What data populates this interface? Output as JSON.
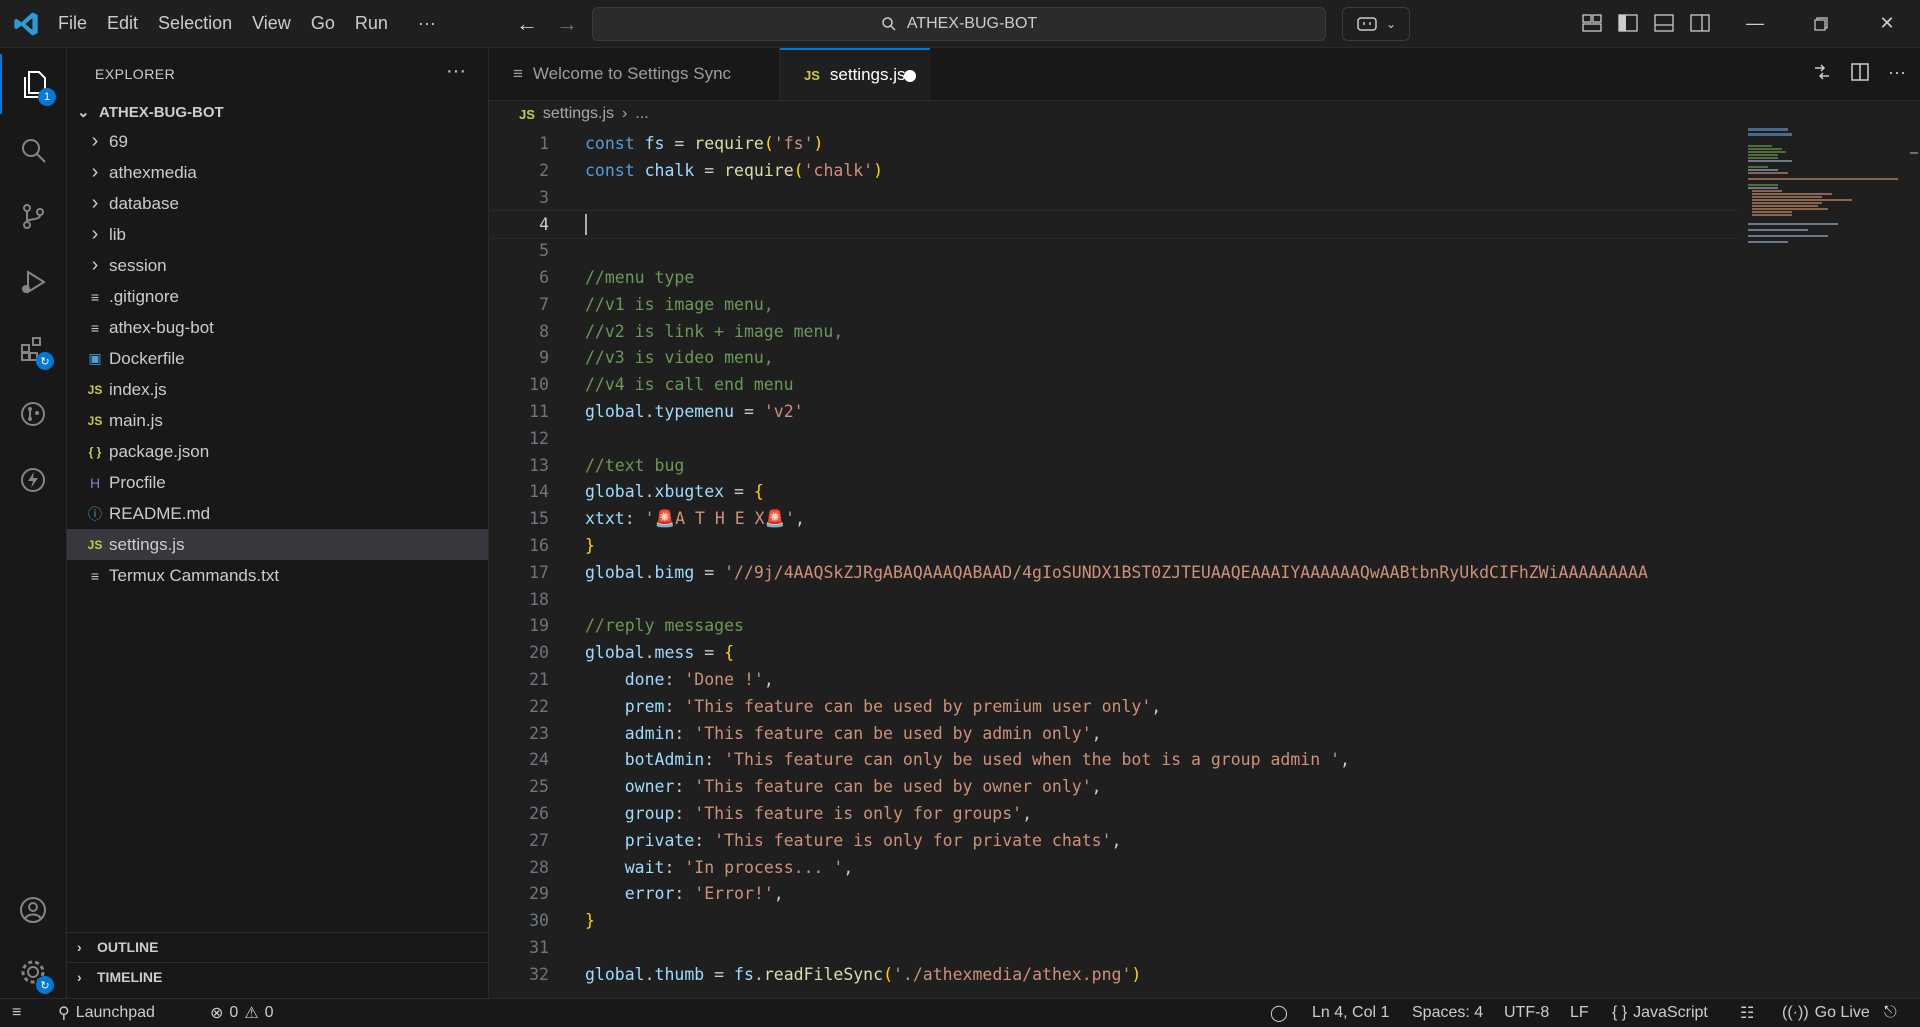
{
  "titlebar": {
    "menus": [
      "File",
      "Edit",
      "Selection",
      "View",
      "Go",
      "Run",
      "···"
    ],
    "search_text": "ATHEX-BUG-BOT"
  },
  "activitybar": {
    "explorer_badge": "1"
  },
  "sidebar": {
    "title": "EXPLORER",
    "more": "···",
    "root": "ATHEX-BUG-BOT",
    "items": [
      {
        "label": "69",
        "kind": "folder"
      },
      {
        "label": "athexmedia",
        "kind": "folder"
      },
      {
        "label": "database",
        "kind": "folder"
      },
      {
        "label": "lib",
        "kind": "folder"
      },
      {
        "label": "session",
        "kind": "folder"
      },
      {
        "label": ".gitignore",
        "kind": "lines"
      },
      {
        "label": "athex-bug-bot",
        "kind": "lines"
      },
      {
        "label": "Dockerfile",
        "kind": "docker"
      },
      {
        "label": "index.js",
        "kind": "js"
      },
      {
        "label": "main.js",
        "kind": "js"
      },
      {
        "label": "package.json",
        "kind": "json"
      },
      {
        "label": "Procfile",
        "kind": "heroku"
      },
      {
        "label": "README.md",
        "kind": "info"
      },
      {
        "label": "settings.js",
        "kind": "js",
        "selected": true
      },
      {
        "label": "Termux Cammands.txt",
        "kind": "lines"
      }
    ],
    "outline": "OUTLINE",
    "timeline": "TIMELINE"
  },
  "tabs": [
    {
      "label": "Welcome to Settings Sync",
      "active": false
    },
    {
      "label": "settings.js",
      "active": true,
      "modified": true
    }
  ],
  "breadcrumb": {
    "file": "settings.js",
    "more": "..."
  },
  "editor": {
    "current_line": 4,
    "lines": [
      [
        [
          "kw",
          "const "
        ],
        [
          "var",
          "fs"
        ],
        [
          "p",
          " = "
        ],
        [
          "fn",
          "require"
        ],
        [
          "br",
          "("
        ],
        [
          "str",
          "'fs'"
        ],
        [
          "br",
          ")"
        ]
      ],
      [
        [
          "kw",
          "const "
        ],
        [
          "var",
          "chalk"
        ],
        [
          "p",
          " = "
        ],
        [
          "fn",
          "require"
        ],
        [
          "br",
          "("
        ],
        [
          "str",
          "'chalk'"
        ],
        [
          "br",
          ")"
        ]
      ],
      [],
      [],
      [],
      [
        [
          "cm",
          "//menu type"
        ]
      ],
      [
        [
          "cm",
          "//v1 is image menu,"
        ]
      ],
      [
        [
          "cm",
          "//v2 is link + image menu,"
        ]
      ],
      [
        [
          "cm",
          "//v3 is video menu,"
        ]
      ],
      [
        [
          "cm",
          "//v4 is call end menu"
        ]
      ],
      [
        [
          "var",
          "global"
        ],
        [
          "p",
          "."
        ],
        [
          "var",
          "typemenu"
        ],
        [
          "p",
          " = "
        ],
        [
          "str",
          "'v2'"
        ]
      ],
      [],
      [
        [
          "cm",
          "//text bug"
        ]
      ],
      [
        [
          "var",
          "global"
        ],
        [
          "p",
          "."
        ],
        [
          "var",
          "xbugtex"
        ],
        [
          "p",
          " = "
        ],
        [
          "br",
          "{"
        ]
      ],
      [
        [
          "var",
          "xtxt"
        ],
        [
          "p",
          ": "
        ],
        [
          "str",
          "'🚨A T H E X🚨'"
        ],
        [
          "p",
          ","
        ]
      ],
      [
        [
          "br",
          "}"
        ]
      ],
      [
        [
          "var",
          "global"
        ],
        [
          "p",
          "."
        ],
        [
          "var",
          "bimg"
        ],
        [
          "p",
          " = "
        ],
        [
          "str",
          "'//9j/4AAQSkZJRgABAQAAAQABAAD/4gIoSUNDX1BST0ZJTEUAAQEAAAIYAAAAAAQwAABtbnRyUkdCIFhZWiAAAAAAAAA"
        ]
      ],
      [],
      [
        [
          "cm",
          "//reply messages"
        ]
      ],
      [
        [
          "var",
          "global"
        ],
        [
          "p",
          "."
        ],
        [
          "var",
          "mess"
        ],
        [
          "p",
          " = "
        ],
        [
          "br",
          "{"
        ]
      ],
      [
        [
          "p",
          "    "
        ],
        [
          "var",
          "done"
        ],
        [
          "p",
          ": "
        ],
        [
          "str",
          "'Done !'"
        ],
        [
          "p",
          ","
        ]
      ],
      [
        [
          "p",
          "    "
        ],
        [
          "var",
          "prem"
        ],
        [
          "p",
          ": "
        ],
        [
          "str",
          "'This feature can be used by premium user only'"
        ],
        [
          "p",
          ","
        ]
      ],
      [
        [
          "p",
          "    "
        ],
        [
          "var",
          "admin"
        ],
        [
          "p",
          ": "
        ],
        [
          "str",
          "'This feature can be used by admin only'"
        ],
        [
          "p",
          ","
        ]
      ],
      [
        [
          "p",
          "    "
        ],
        [
          "var",
          "botAdmin"
        ],
        [
          "p",
          ": "
        ],
        [
          "str",
          "'This feature can only be used when the bot is a group admin '"
        ],
        [
          "p",
          ","
        ]
      ],
      [
        [
          "p",
          "    "
        ],
        [
          "var",
          "owner"
        ],
        [
          "p",
          ": "
        ],
        [
          "str",
          "'This feature can be used by owner only'"
        ],
        [
          "p",
          ","
        ]
      ],
      [
        [
          "p",
          "    "
        ],
        [
          "var",
          "group"
        ],
        [
          "p",
          ": "
        ],
        [
          "str",
          "'This feature is only for groups'"
        ],
        [
          "p",
          ","
        ]
      ],
      [
        [
          "p",
          "    "
        ],
        [
          "var",
          "private"
        ],
        [
          "p",
          ": "
        ],
        [
          "str",
          "'This feature is only for private chats'"
        ],
        [
          "p",
          ","
        ]
      ],
      [
        [
          "p",
          "    "
        ],
        [
          "var",
          "wait"
        ],
        [
          "p",
          ": "
        ],
        [
          "str",
          "'In process... '"
        ],
        [
          "p",
          ","
        ]
      ],
      [
        [
          "p",
          "    "
        ],
        [
          "var",
          "error"
        ],
        [
          "p",
          ": "
        ],
        [
          "str",
          "'Error!'"
        ],
        [
          "p",
          ","
        ]
      ],
      [
        [
          "br",
          "}"
        ]
      ],
      [],
      [
        [
          "var",
          "global"
        ],
        [
          "p",
          "."
        ],
        [
          "var",
          "thumb"
        ],
        [
          "p",
          " = "
        ],
        [
          "var",
          "fs"
        ],
        [
          "p",
          "."
        ],
        [
          "fn",
          "readFileSync"
        ],
        [
          "br",
          "("
        ],
        [
          "str",
          "'./athexmedia/athex.png'"
        ],
        [
          "br",
          ")"
        ]
      ]
    ]
  },
  "statusbar": {
    "launchpad": "Launchpad",
    "errors": "0",
    "warnings": "0",
    "position": "Ln 4, Col 1",
    "spaces": "Spaces: 4",
    "encoding": "UTF-8",
    "eol": "LF",
    "language_braces": "{ }",
    "language": "JavaScript",
    "golive": "Go Live"
  },
  "colors": {
    "accent": "#0078d4",
    "badge": "#0078d4",
    "js_icon": "#cbcb41",
    "docker_icon": "#4aa1e0",
    "heroku_icon": "#a074c4",
    "info_icon": "#519aba"
  }
}
